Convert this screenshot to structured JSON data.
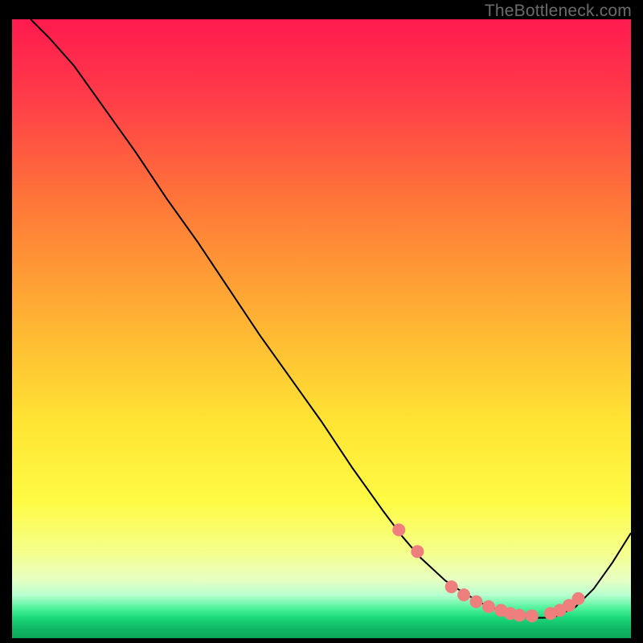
{
  "watermark": "TheBottleneck.com",
  "chart_data": {
    "type": "line",
    "title": "",
    "xlabel": "",
    "ylabel": "",
    "xlim": [
      0,
      100
    ],
    "ylim": [
      0,
      100
    ],
    "grid": false,
    "legend": false,
    "background_gradient": {
      "stops": [
        {
          "offset": 0.0,
          "color": "#ff1a4f"
        },
        {
          "offset": 0.12,
          "color": "#ff3a49"
        },
        {
          "offset": 0.3,
          "color": "#ff7838"
        },
        {
          "offset": 0.5,
          "color": "#ffb733"
        },
        {
          "offset": 0.65,
          "color": "#ffe433"
        },
        {
          "offset": 0.78,
          "color": "#fffb45"
        },
        {
          "offset": 0.86,
          "color": "#f5ff8a"
        },
        {
          "offset": 0.905,
          "color": "#e8ffc2"
        },
        {
          "offset": 0.93,
          "color": "#b8ffcf"
        },
        {
          "offset": 0.952,
          "color": "#4ef29a"
        },
        {
          "offset": 0.965,
          "color": "#1fdc7e"
        },
        {
          "offset": 0.975,
          "color": "#15c96f"
        },
        {
          "offset": 0.985,
          "color": "#0fb862"
        },
        {
          "offset": 1.0,
          "color": "#0aa656"
        }
      ]
    },
    "series": [
      {
        "name": "bottleneck-curve",
        "color": "#000000",
        "stroke_width": 2,
        "x": [
          3,
          6,
          10,
          15,
          20,
          25,
          30,
          35,
          40,
          45,
          50,
          55,
          60,
          63,
          66,
          70,
          73,
          76,
          79,
          82,
          84,
          86,
          88,
          91,
          94,
          97,
          100
        ],
        "y": [
          100,
          97,
          92.5,
          85.5,
          78.5,
          71,
          64,
          56.5,
          49,
          42,
          35,
          27.5,
          20.5,
          16.5,
          13,
          9.3,
          7.3,
          5.6,
          4.4,
          3.6,
          3.3,
          3.3,
          3.6,
          5.0,
          8.0,
          12.2,
          17
        ]
      }
    ],
    "markers": {
      "name": "curve-dots",
      "color": "#ef7f7d",
      "radius": 8,
      "x": [
        62.5,
        65.5,
        71.0,
        73.0,
        75.0,
        77.0,
        79.0,
        80.5,
        82.0,
        84.0,
        87.0,
        88.5,
        90.0,
        91.5
      ],
      "y": [
        17.5,
        14.0,
        8.3,
        7.0,
        5.9,
        5.1,
        4.5,
        4.0,
        3.7,
        3.6,
        4.0,
        4.5,
        5.3,
        6.4
      ]
    }
  }
}
